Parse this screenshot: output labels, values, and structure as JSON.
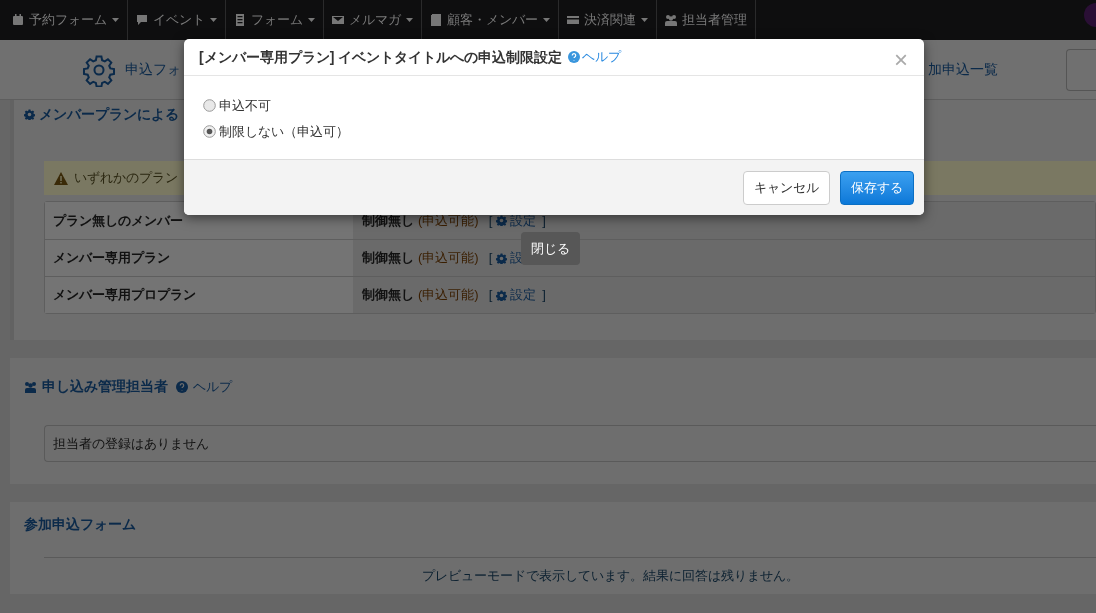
{
  "navbar": {
    "items": [
      {
        "label": "予約フォーム",
        "dropdown": true
      },
      {
        "label": "イベント",
        "dropdown": true
      },
      {
        "label": "フォーム",
        "dropdown": true
      },
      {
        "label": "メルマガ",
        "dropdown": true
      },
      {
        "label": "顧客・メンバー",
        "dropdown": true
      },
      {
        "label": "決済関連",
        "dropdown": true
      },
      {
        "label": "担当者管理",
        "dropdown": false
      }
    ]
  },
  "subheader": {
    "left_tab": "申込フォ",
    "right_tab": "加申込一覧"
  },
  "plan_section": {
    "title": "メンバープランによる",
    "warning": "いずれかのプラン",
    "rows": [
      {
        "name": "プラン無しのメンバー",
        "status": "制御無し",
        "note": "(申込可能)",
        "bracket_open": "[",
        "action": "設定",
        "bracket_close": "]"
      },
      {
        "name": "メンバー専用プラン",
        "status": "制御無し",
        "note": "(申込可能)",
        "bracket_open": "[",
        "action": "設"
      },
      {
        "name": "メンバー専用プロプラン",
        "status": "制御無し",
        "note": "(申込可能)",
        "bracket_open": "[",
        "action": "設定",
        "bracket_close": "]"
      }
    ]
  },
  "manager_section": {
    "title": "申し込み管理担当者",
    "help": "ヘルプ",
    "empty_text": "担当者の登録はありません"
  },
  "form_section": {
    "title": "参加申込フォーム",
    "preview_note": "プレビューモードで表示しています。結果に回答は残りません。"
  },
  "modal": {
    "title": "[メンバー専用プラン] イベントタイトルへの申込制限設定",
    "help": "ヘルプ",
    "close": "×",
    "options": [
      {
        "label": "申込不可",
        "selected": false
      },
      {
        "label": "制限しない（申込可）",
        "selected": true
      }
    ],
    "cancel": "キャンセル",
    "save": "保存する"
  },
  "tooltip": "閉じる"
}
